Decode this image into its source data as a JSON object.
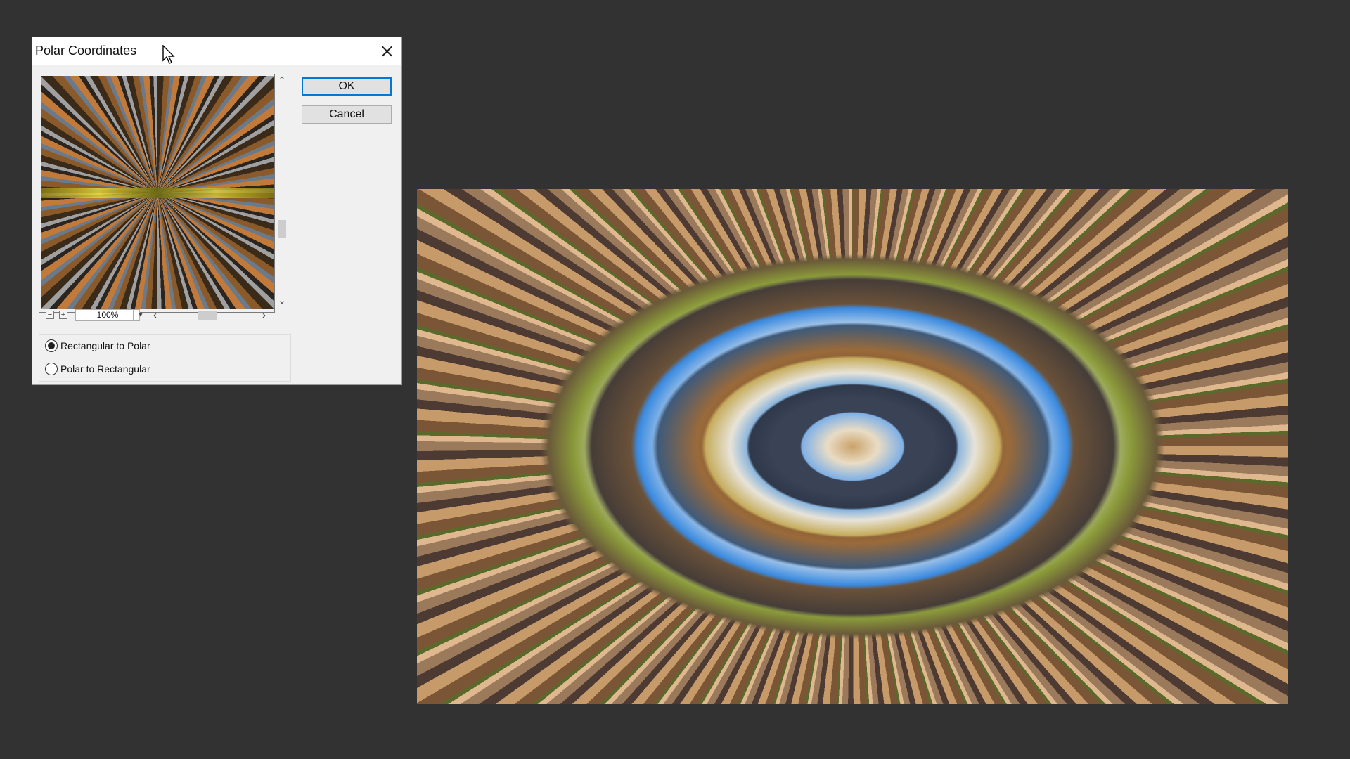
{
  "dialog": {
    "title": "Polar Coordinates",
    "ok_label": "OK",
    "cancel_label": "Cancel",
    "zoom_value": "100%",
    "options": [
      {
        "label": "Rectangular to Polar",
        "checked": true
      },
      {
        "label": "Polar to Rectangular",
        "checked": false
      }
    ]
  },
  "icons": {
    "close": "close-icon",
    "zoom_out": "zoom-out-icon",
    "zoom_in": "zoom-in-icon",
    "dropdown": "chevron-down-icon",
    "scroll_up": "chevron-up-icon",
    "scroll_down": "chevron-down-icon",
    "scroll_left": "chevron-left-icon",
    "scroll_right": "chevron-right-icon",
    "cursor": "arrow-cursor-icon"
  },
  "colors": {
    "workspace_bg": "#323232",
    "dialog_bg": "#f0f0f0",
    "default_button_border": "#0078d7"
  }
}
